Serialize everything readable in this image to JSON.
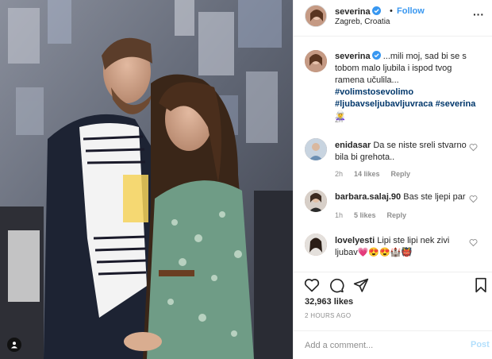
{
  "post": {
    "image_alt": "Couple embracing in front of a mural",
    "header": {
      "username": "severina",
      "dot": "•",
      "follow_label": "Follow",
      "location": "Zagreb, Croatia",
      "more": "···"
    },
    "caption": {
      "username": "severina",
      "text": "...mili moj, sad bi se s tobom malo ljubila i ispod tvog ramena učulila...",
      "hashtags": "#volimstosevolimo #ljubavseljubavljuvraca #severina",
      "emoji": "🧝‍♀️",
      "time": "2h"
    },
    "comments": [
      {
        "username": "enidasar",
        "text": "Da se niste sreli stvarno bila bi grehota..",
        "time": "2h",
        "likes": "14 likes",
        "reply": "Reply"
      },
      {
        "username": "barbara.salaj.90",
        "text": "Bas ste ljepi par",
        "time": "1h",
        "likes": "5 likes",
        "reply": "Reply"
      },
      {
        "username": "lovelyesti",
        "text": "Lipi ste lipi nek zivi ljubav💗😍😍🏰👹",
        "time": "",
        "likes": "",
        "reply": ""
      }
    ],
    "likes_count": "32,963 likes",
    "posted_ago": "2 HOURS AGO",
    "add_comment": {
      "placeholder": "Add a comment...",
      "post_label": "Post"
    }
  },
  "colors": {
    "accent": "#3897f0",
    "hashtag": "#00376b",
    "muted": "#8e8e8e",
    "post_disabled": "#b2dffc"
  },
  "icons": [
    "verified-badge-icon",
    "more-options-icon",
    "heart-icon",
    "comment-icon",
    "share-icon",
    "bookmark-icon",
    "user-tag-icon"
  ]
}
